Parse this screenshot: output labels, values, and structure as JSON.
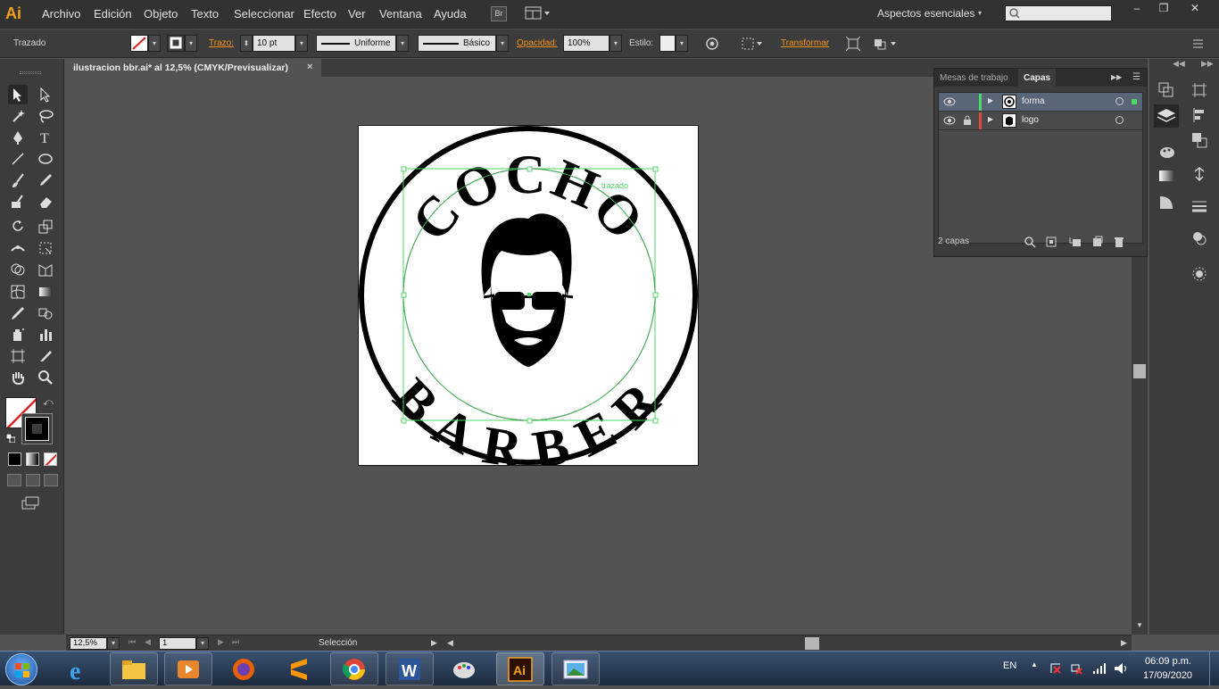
{
  "app": {
    "logo": "Ai",
    "menu": [
      "Archivo",
      "Edición",
      "Objeto",
      "Texto",
      "Seleccionar",
      "Efecto",
      "Ver",
      "Ventana",
      "Ayuda"
    ],
    "bridge_button": "Br",
    "workspace": "Aspectos esenciales",
    "window_controls": [
      "–",
      "❐",
      "✕"
    ]
  },
  "control_bar": {
    "object_type": "Trazado",
    "stroke_label": "Trazo:",
    "stroke_weight": "10 pt",
    "variable_width": "Uniforme",
    "brush": "Básico",
    "opacity_label": "Opacidad:",
    "opacity": "100%",
    "style_label": "Estilo:",
    "transform_link": "Transformar"
  },
  "document": {
    "tab_title": "ilustracion bbr.ai* al 12,5% (CMYK/Previsualizar)",
    "close": "×"
  },
  "artwork": {
    "top_text": "COCHO",
    "bottom_text": "BARBER",
    "path_hint": "trazado"
  },
  "status_bar": {
    "zoom": "12,5%",
    "artboard": "1",
    "tool": "Selección"
  },
  "layers_panel": {
    "tabs": [
      "Mesas de trabajo",
      "Capas"
    ],
    "layers": [
      {
        "name": "forma",
        "color": "#4cd964",
        "locked": false,
        "selected": true
      },
      {
        "name": "logo",
        "color": "#e0483e",
        "locked": true,
        "selected": false
      }
    ],
    "count": "2 capas"
  },
  "taskbar": {
    "language": "EN",
    "time": "06:09 p.m.",
    "date": "17/09/2020"
  },
  "colors": {
    "ai_orange": "#f7a21b",
    "selection_green": "#4cd964",
    "panel_bg": "#3c3c3c",
    "canvas_bg": "#535353"
  }
}
